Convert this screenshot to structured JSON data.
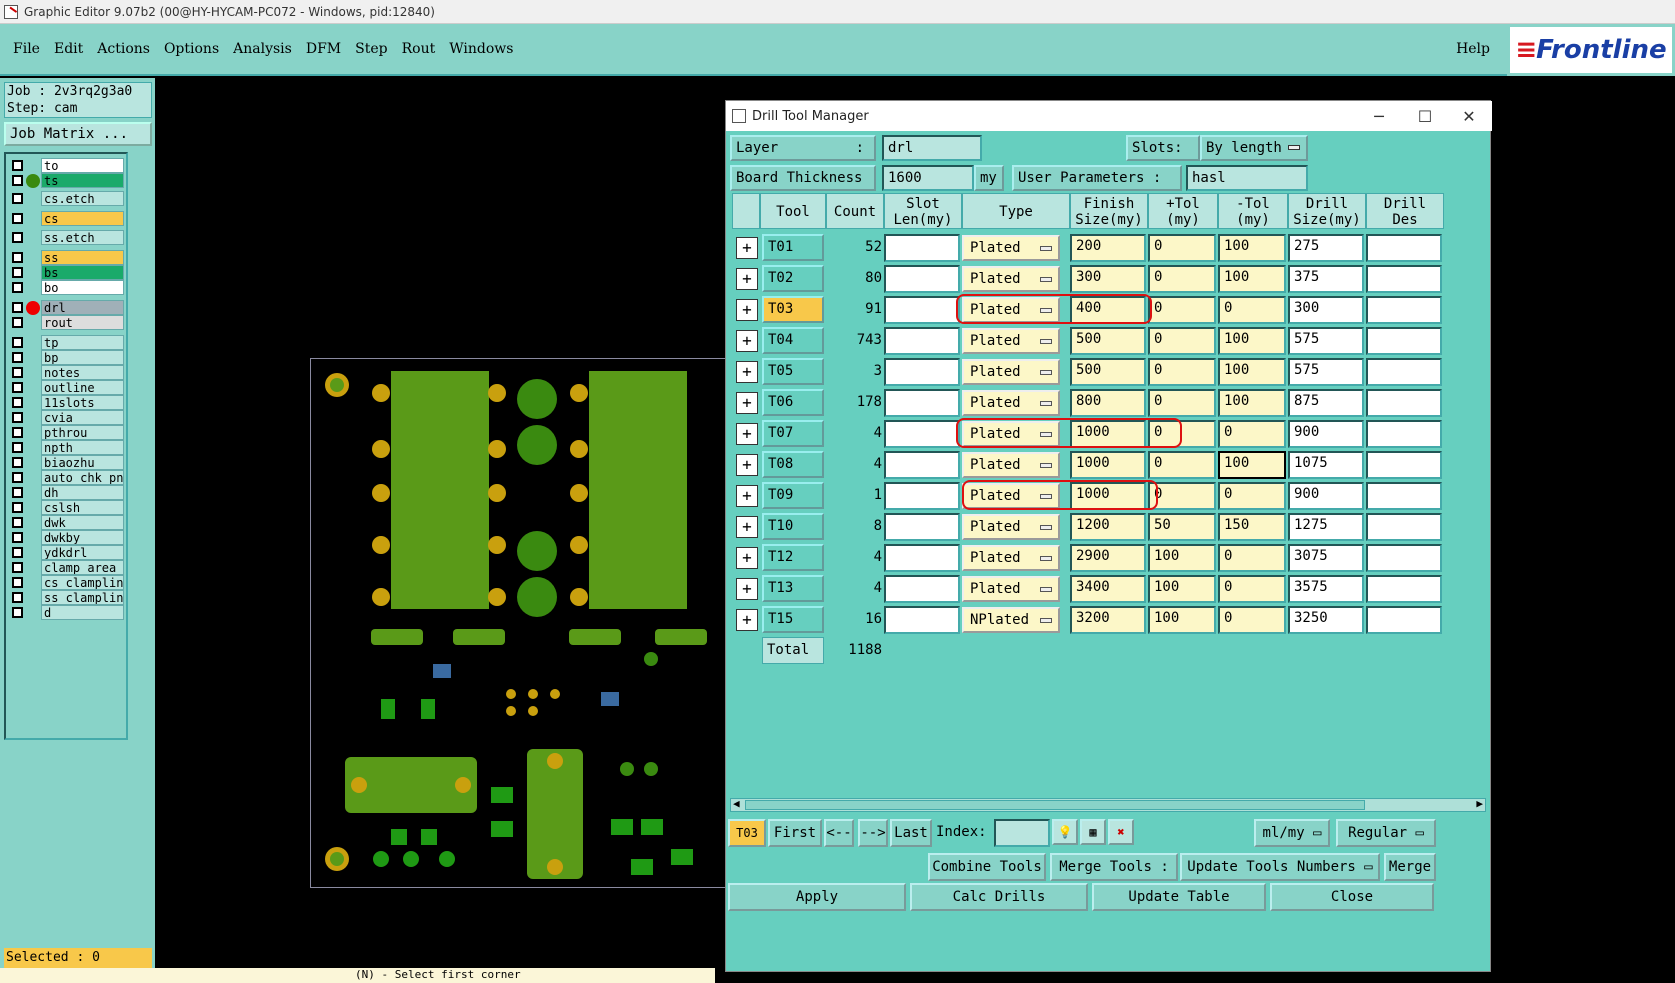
{
  "window_title": "Graphic Editor 9.07b2 (00@HY-HYCAM-PC072 - Windows, pid:12840)",
  "menu": [
    "File",
    "Edit",
    "Actions",
    "Options",
    "Analysis",
    "DFM",
    "Step",
    "Rout",
    "Windows"
  ],
  "help_label": "Help",
  "logo_text": "Frontline",
  "left_panel": {
    "job": "Job : 2v3rq2g3a0",
    "step": "Step: cam",
    "job_matrix": "Job Matrix ...",
    "layers": [
      {
        "name": "to",
        "color": "#ffffff"
      },
      {
        "name": "ts",
        "color": "#1aaa6a"
      },
      {
        "name": "cs.etch",
        "color": "#b9e5df"
      },
      {
        "name": "cs",
        "color": "#f8c84a"
      },
      {
        "name": "ss.etch",
        "color": "#b9e5df"
      },
      {
        "name": "ss",
        "color": "#f8c84a"
      },
      {
        "name": "bs",
        "color": "#1aaa6a"
      },
      {
        "name": "bo",
        "color": "#ffffff"
      },
      {
        "name": "drl",
        "color": "#a0b0b8"
      },
      {
        "name": "rout",
        "color": "#dddddd"
      },
      {
        "name": "tp",
        "color": "#b9e5df"
      },
      {
        "name": "bp",
        "color": "#b9e5df"
      },
      {
        "name": "notes",
        "color": "#b9e5df"
      },
      {
        "name": "outline",
        "color": "#b9e5df"
      },
      {
        "name": "11slots",
        "color": "#b9e5df"
      },
      {
        "name": "cvia",
        "color": "#b9e5df"
      },
      {
        "name": "pthrou",
        "color": "#b9e5df"
      },
      {
        "name": "npth",
        "color": "#b9e5df"
      },
      {
        "name": "biaozhu",
        "color": "#b9e5df"
      },
      {
        "name": "auto_chk_pnl",
        "color": "#b9e5df"
      },
      {
        "name": "dh",
        "color": "#b9e5df"
      },
      {
        "name": "cslsh",
        "color": "#b9e5df"
      },
      {
        "name": "dwk",
        "color": "#b9e5df"
      },
      {
        "name": "dwkby",
        "color": "#b9e5df"
      },
      {
        "name": "ydkdrl",
        "color": "#b9e5df"
      },
      {
        "name": "clamp_area",
        "color": "#b9e5df"
      },
      {
        "name": "cs_clampline",
        "color": "#b9e5df"
      },
      {
        "name": "ss_clampline",
        "color": "#b9e5df"
      },
      {
        "name": "d",
        "color": "#b9e5df"
      }
    ],
    "selected": "Selected : 0"
  },
  "status": {
    "command_hint": "(N) - Select first corner"
  },
  "dialog": {
    "title": "Drill Tool Manager",
    "layer_label": "Layer",
    "layer_value": "drl",
    "slots_label": "Slots:",
    "slots_value": "By length",
    "board_thickness_label": "Board Thickness :",
    "board_thickness_value": "1600",
    "board_thickness_unit": "my",
    "user_params_label": "User Parameters :",
    "user_params_value": "hasl",
    "columns": [
      "Tool",
      "Count",
      "Slot\nLen(my)",
      "Type",
      "Finish\nSize(my)",
      "+Tol\n(my)",
      "-Tol\n(my)",
      "Drill\nSize(my)",
      "Drill\nDes"
    ],
    "rows": [
      {
        "tool": "T01",
        "count": "52",
        "type": "Plated",
        "finish": "200",
        "ptol": "0",
        "mtol": "100",
        "drill": "275"
      },
      {
        "tool": "T02",
        "count": "80",
        "type": "Plated",
        "finish": "300",
        "ptol": "0",
        "mtol": "100",
        "drill": "375"
      },
      {
        "tool": "T03",
        "count": "91",
        "type": "Plated",
        "finish": "400",
        "ptol": "0",
        "mtol": "0",
        "drill": "300"
      },
      {
        "tool": "T04",
        "count": "743",
        "type": "Plated",
        "finish": "500",
        "ptol": "0",
        "mtol": "100",
        "drill": "575"
      },
      {
        "tool": "T05",
        "count": "3",
        "type": "Plated",
        "finish": "500",
        "ptol": "0",
        "mtol": "100",
        "drill": "575"
      },
      {
        "tool": "T06",
        "count": "178",
        "type": "Plated",
        "finish": "800",
        "ptol": "0",
        "mtol": "100",
        "drill": "875"
      },
      {
        "tool": "T07",
        "count": "4",
        "type": "Plated",
        "finish": "1000",
        "ptol": "0",
        "mtol": "0",
        "drill": "900"
      },
      {
        "tool": "T08",
        "count": "4",
        "type": "Plated",
        "finish": "1000",
        "ptol": "0",
        "mtol": "100",
        "drill": "1075"
      },
      {
        "tool": "T09",
        "count": "1",
        "type": "Plated",
        "finish": "1000",
        "ptol": "0",
        "mtol": "0",
        "drill": "900"
      },
      {
        "tool": "T10",
        "count": "8",
        "type": "Plated",
        "finish": "1200",
        "ptol": "50",
        "mtol": "150",
        "drill": "1275"
      },
      {
        "tool": "T12",
        "count": "4",
        "type": "Plated",
        "finish": "2900",
        "ptol": "100",
        "mtol": "0",
        "drill": "3075"
      },
      {
        "tool": "T13",
        "count": "4",
        "type": "Plated",
        "finish": "3400",
        "ptol": "100",
        "mtol": "0",
        "drill": "3575"
      },
      {
        "tool": "T15",
        "count": "16",
        "type": "NPlated",
        "finish": "3200",
        "ptol": "100",
        "mtol": "0",
        "drill": "3250"
      }
    ],
    "total_label": "Total",
    "total_count": "1188",
    "current_tool": "T03",
    "nav": {
      "first": "First",
      "prev": "<--",
      "next": "-->",
      "last": "Last",
      "index_label": "Index:",
      "units": "ml/my",
      "mode": "Regular"
    },
    "buttons": {
      "combine": "Combine Tools",
      "merge_tools": "Merge Tools :",
      "update_numbers": "Update Tools Numbers",
      "merge": "Merge",
      "apply": "Apply",
      "calc": "Calc Drills",
      "update_table": "Update Table",
      "close": "Close"
    }
  }
}
